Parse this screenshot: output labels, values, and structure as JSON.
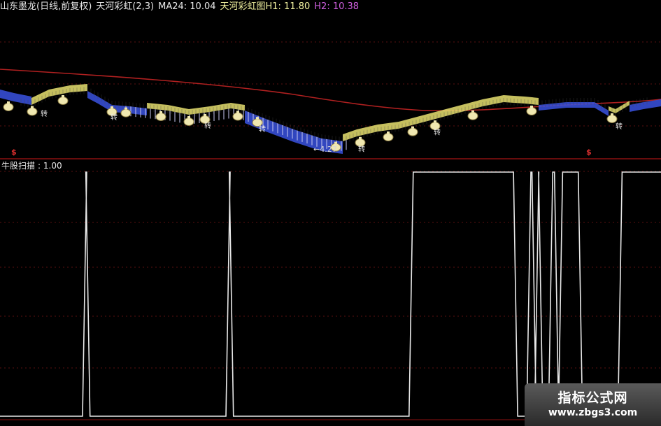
{
  "header": {
    "instrument": "山东墨龙(日线,前复权)",
    "indicator": "天河彩虹(2,3)",
    "ma24_label": "MA24: 10.04",
    "rainbow_label": "天河彩虹图H1: 11.80",
    "h2_label": "H2: 10.38"
  },
  "upper_panel": {
    "low_price_label": "4.27",
    "signal_char": "转",
    "dollar_marker": "$",
    "colors": {
      "ma_line": "#b02020",
      "down_band": "#3a52e0",
      "up_band": "#e8e070",
      "token": "#f0e8b0",
      "panel_border": "#8a1010"
    }
  },
  "lower_panel": {
    "label": "牛股扫描",
    "value": ": 1.00",
    "signal_segments": [
      [
        0.0,
        0
      ],
      [
        0.128,
        1
      ],
      [
        0.133,
        0
      ],
      [
        0.345,
        1
      ],
      [
        0.35,
        0
      ],
      [
        0.622,
        1
      ],
      [
        0.78,
        0
      ],
      [
        0.8,
        1
      ],
      [
        0.808,
        0
      ],
      [
        0.812,
        1
      ],
      [
        0.818,
        0
      ],
      [
        0.833,
        1
      ],
      [
        0.842,
        0
      ],
      [
        0.848,
        1
      ],
      [
        0.878,
        0
      ],
      [
        0.938,
        1
      ],
      [
        1.0,
        1
      ]
    ]
  },
  "watermark": {
    "title": "指标公式网",
    "url": "www.zbgs3.com"
  }
}
